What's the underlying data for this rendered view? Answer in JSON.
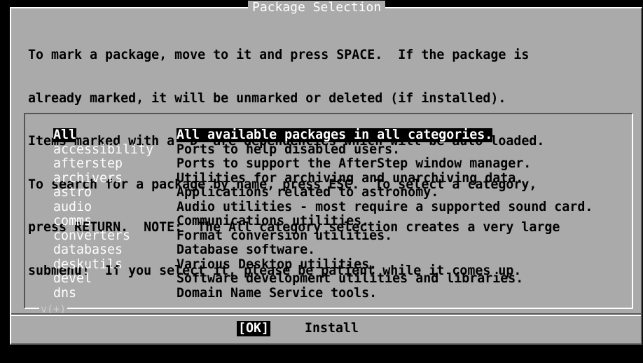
{
  "dialog": {
    "title": "Package Selection",
    "instructions": [
      "To mark a package, move to it and press SPACE.  If the package is",
      "already marked, it will be unmarked or deleted (if installed).",
      "Items marked with a `D' are dependencies which will be auto-loaded.",
      "To search for a package by name, press ESC.  To select a category,",
      "press RETURN.  NOTE:  The All category selection creates a very large",
      "submenu!  If you select it, please be patient while it comes up."
    ]
  },
  "list": {
    "items": [
      {
        "name": "All",
        "desc": "All available packages in all categories."
      },
      {
        "name": "accessibility",
        "desc": "Ports to help disabled users."
      },
      {
        "name": "afterstep",
        "desc": "Ports to support the AfterStep window manager."
      },
      {
        "name": "archivers",
        "desc": "Utilities for archiving and unarchiving data."
      },
      {
        "name": "astro",
        "desc": "Applications related to astronomy."
      },
      {
        "name": "audio",
        "desc": "Audio utilities - most require a supported sound card."
      },
      {
        "name": "comms",
        "desc": "Communications utilities."
      },
      {
        "name": "converters",
        "desc": "Format conversion utilities."
      },
      {
        "name": "databases",
        "desc": "Database software."
      },
      {
        "name": "deskutils",
        "desc": "Various Desktop utilities."
      },
      {
        "name": "devel",
        "desc": "Software development utilities and libraries."
      },
      {
        "name": "dns",
        "desc": "Domain Name Service tools."
      }
    ],
    "more_indicator": "v(+)"
  },
  "buttons": {
    "ok": "[OK]",
    "install": "Install"
  },
  "colors": {
    "background": "#aaaaaa",
    "highlight": "#ffffff",
    "shadow": "#555555",
    "screen": "#000000"
  }
}
